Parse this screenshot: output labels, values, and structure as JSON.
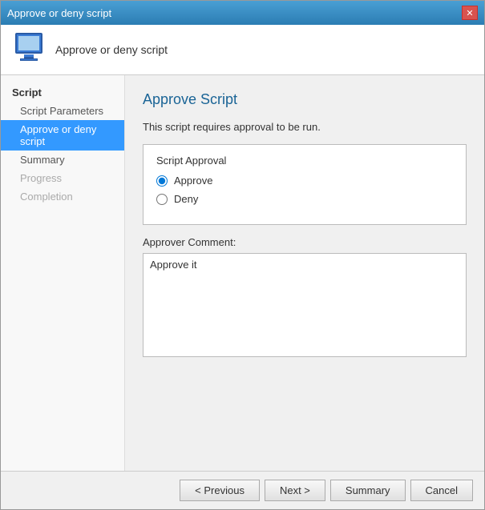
{
  "window": {
    "title": "Approve or deny script",
    "close_label": "✕"
  },
  "header": {
    "icon_alt": "computer-icon",
    "text": "Approve or deny script"
  },
  "sidebar": {
    "section_label": "Script",
    "items": [
      {
        "id": "script-parameters",
        "label": "Script Parameters",
        "state": "normal"
      },
      {
        "id": "approve-or-deny-script",
        "label": "Approve or deny script",
        "state": "active"
      },
      {
        "id": "summary",
        "label": "Summary",
        "state": "normal"
      },
      {
        "id": "progress",
        "label": "Progress",
        "state": "disabled"
      },
      {
        "id": "completion",
        "label": "Completion",
        "state": "disabled"
      }
    ]
  },
  "main": {
    "title": "Approve Script",
    "info_text": "This script requires approval to be run.",
    "group_box": {
      "label": "Script Approval",
      "options": [
        {
          "id": "approve",
          "label": "Approve",
          "checked": true
        },
        {
          "id": "deny",
          "label": "Deny",
          "checked": false
        }
      ]
    },
    "comment_label": "Approver Comment:",
    "comment_value": "Approve it"
  },
  "footer": {
    "previous_label": "< Previous",
    "next_label": "Next >",
    "summary_label": "Summary",
    "cancel_label": "Cancel"
  }
}
